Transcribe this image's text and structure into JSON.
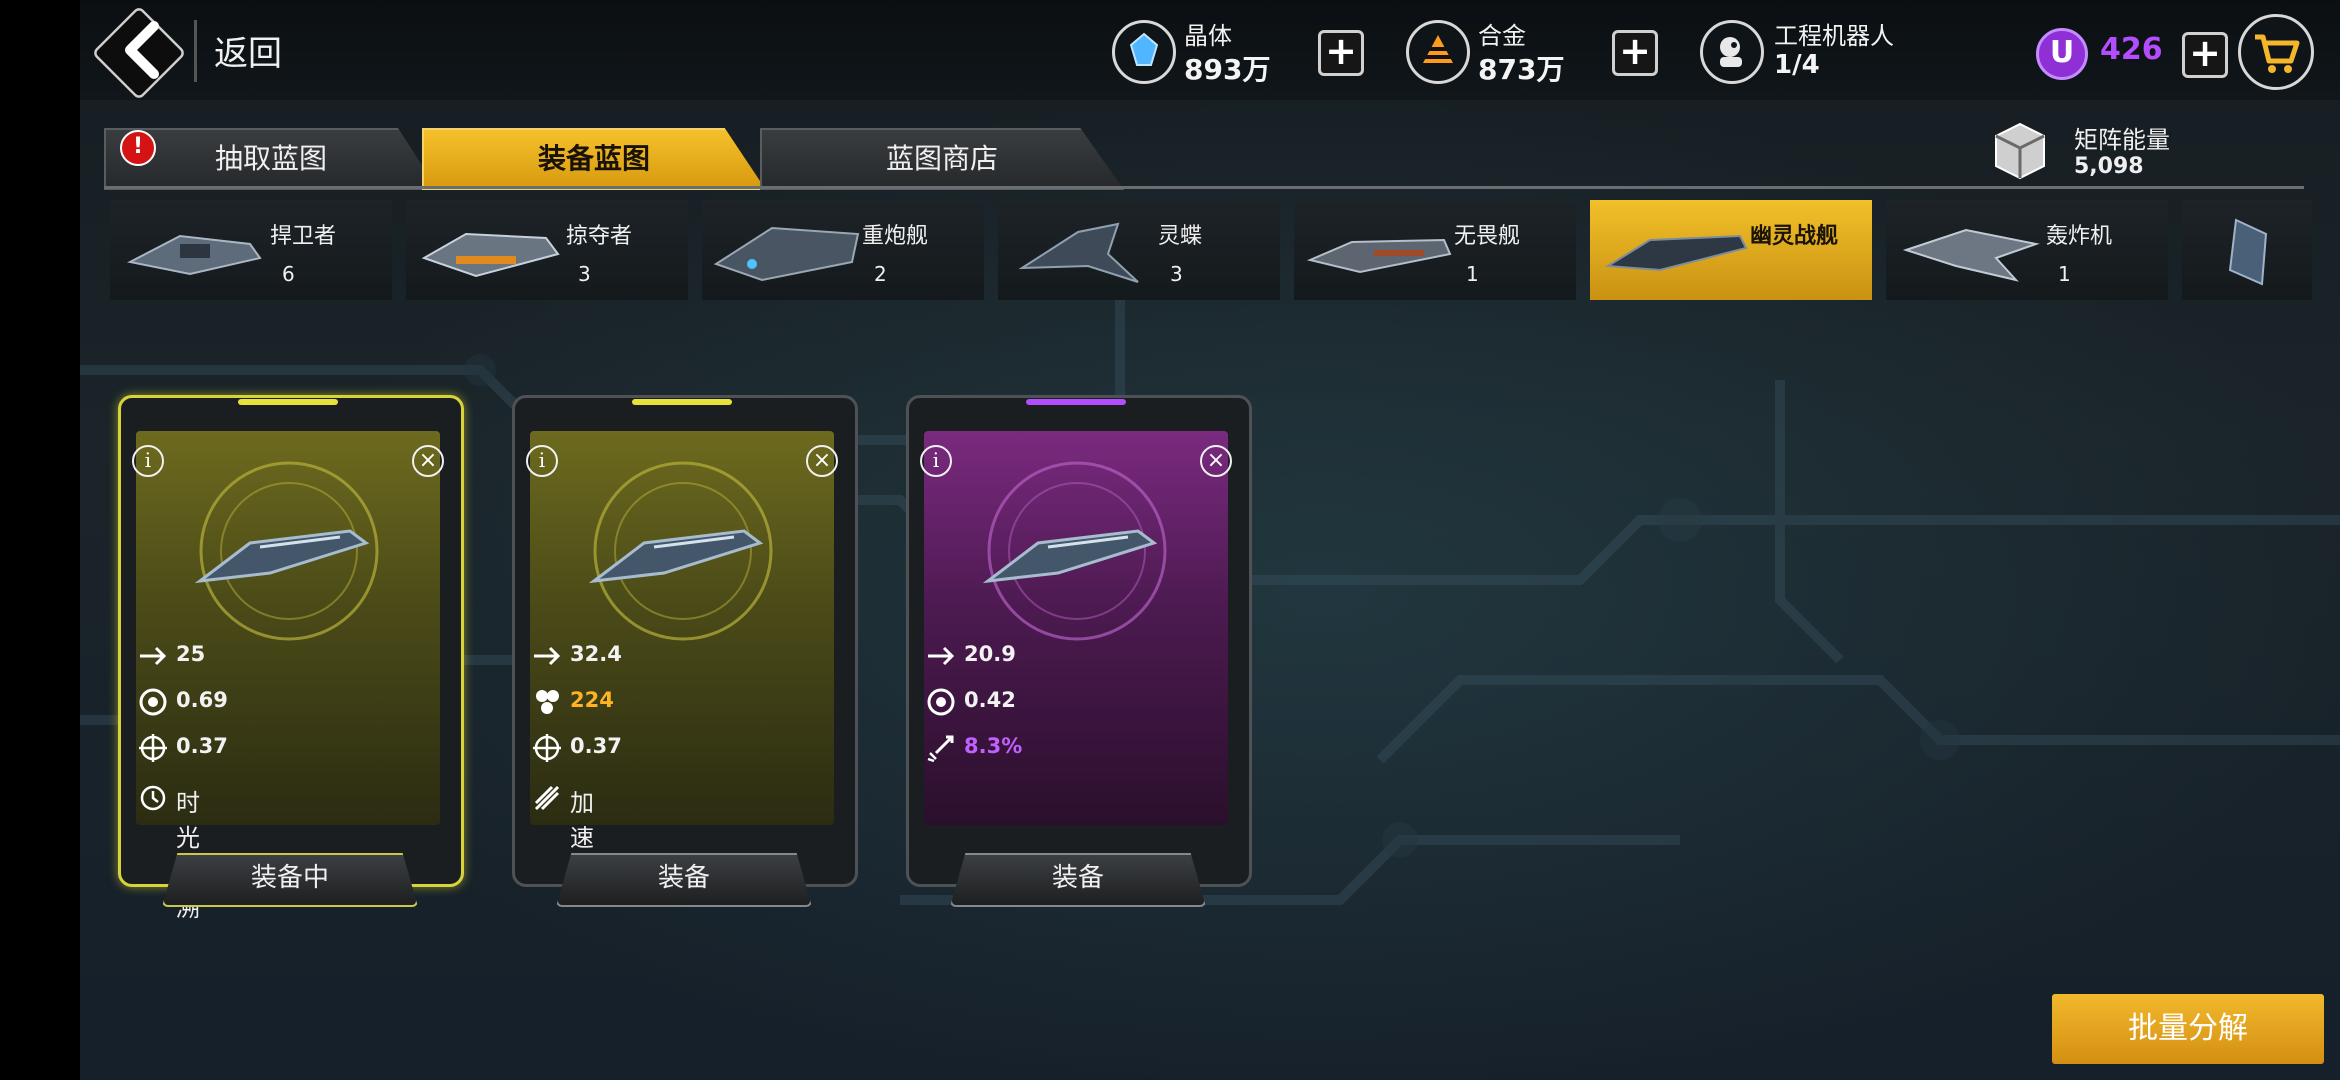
{
  "header": {
    "back_label": "返回",
    "resources": [
      {
        "icon": "crystal-icon",
        "name": "晶体",
        "value": "893万",
        "color": "#4fb6ff"
      },
      {
        "icon": "alloy-icon",
        "name": "合金",
        "value": "873万",
        "color": "#ff9a1a"
      },
      {
        "icon": "robot-icon",
        "name": "工程机器人",
        "value": "1/4"
      }
    ],
    "currency": {
      "icon": "u-coin-icon",
      "value": "426",
      "color": "#b44dff"
    },
    "cart_icon": "shopping-cart-icon"
  },
  "tabs": [
    {
      "label": "抽取蓝图",
      "active": false,
      "alert": "!"
    },
    {
      "label": "装备蓝图",
      "active": true
    },
    {
      "label": "蓝图商店",
      "active": false
    }
  ],
  "matrix": {
    "label": "矩阵能量",
    "value": "5,098"
  },
  "ships": [
    {
      "name": "捍卫者",
      "count": "6"
    },
    {
      "name": "掠夺者",
      "count": "3"
    },
    {
      "name": "重炮舰",
      "count": "2"
    },
    {
      "name": "灵蝶",
      "count": "3"
    },
    {
      "name": "无畏舰",
      "count": "1"
    },
    {
      "name": "幽灵战舰",
      "count": "",
      "active": true
    },
    {
      "name": "轰炸机",
      "count": "1"
    }
  ],
  "cards": [
    {
      "rarity": "gold",
      "stats": [
        {
          "icon": "speed-arrow-icon",
          "value": "25"
        },
        {
          "icon": "shield-ring-icon",
          "value": "0.69"
        },
        {
          "icon": "crosshair-icon",
          "value": "0.37"
        }
      ],
      "skill": {
        "icon": "time-rewind-icon",
        "label": "时光回溯"
      },
      "button": "装备中",
      "equipped": true
    },
    {
      "rarity": "gold",
      "stats": [
        {
          "icon": "speed-arrow-icon",
          "value": "32.4"
        },
        {
          "icon": "hex-cluster-icon",
          "value": "224",
          "highlight": "orange"
        },
        {
          "icon": "crosshair-icon",
          "value": "0.37"
        }
      ],
      "skill": {
        "icon": "boost-icon",
        "label": "加速"
      },
      "button": "装备",
      "equipped": false
    },
    {
      "rarity": "purple",
      "stats": [
        {
          "icon": "speed-arrow-icon",
          "value": "20.9"
        },
        {
          "icon": "shield-ring-icon",
          "value": "0.42"
        },
        {
          "icon": "missile-icon",
          "value": "8.3%",
          "highlight": "purple"
        }
      ],
      "button": "装备",
      "equipped": false
    }
  ],
  "bulk_button": "批量分解"
}
